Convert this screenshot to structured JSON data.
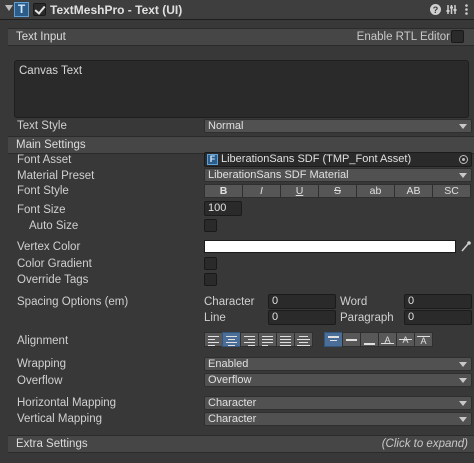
{
  "header": {
    "title": "TextMeshPro - Text (UI)",
    "enabled": true,
    "icons": [
      "help-icon",
      "presets-icon",
      "context-menu-icon"
    ]
  },
  "text_input": {
    "section_title": "Text Input",
    "rtl_label": "Enable RTL Editor",
    "rtl_checked": false,
    "text": "Canvas Text"
  },
  "text_style": {
    "label": "Text Style",
    "value": "Normal"
  },
  "main_settings": {
    "section_title": "Main Settings",
    "font_asset": {
      "label": "Font Asset",
      "value": "LiberationSans SDF (TMP_Font Asset)"
    },
    "material_preset": {
      "label": "Material Preset",
      "value": "LiberationSans SDF Material"
    },
    "font_style": {
      "label": "Font Style",
      "buttons": [
        "B",
        "I",
        "U",
        "S",
        "ab",
        "AB",
        "SC"
      ]
    },
    "font_size": {
      "label": "Font Size",
      "value": "100"
    },
    "auto_size": {
      "label": "Auto Size",
      "checked": false
    },
    "vertex_color": {
      "label": "Vertex Color",
      "color": "#ffffff"
    },
    "color_gradient": {
      "label": "Color Gradient",
      "checked": false
    },
    "override_tags": {
      "label": "Override Tags",
      "checked": false
    },
    "spacing": {
      "label": "Spacing Options (em)",
      "character_label": "Character",
      "character_value": "0",
      "word_label": "Word",
      "word_value": "0",
      "line_label": "Line",
      "line_value": "0",
      "paragraph_label": "Paragraph",
      "paragraph_value": "0"
    },
    "alignment": {
      "label": "Alignment",
      "horizontal_selected": "center",
      "vertical_selected": "top"
    },
    "wrapping": {
      "label": "Wrapping",
      "value": "Enabled"
    },
    "overflow": {
      "label": "Overflow",
      "value": "Overflow"
    },
    "horizontal_mapping": {
      "label": "Horizontal Mapping",
      "value": "Character"
    },
    "vertical_mapping": {
      "label": "Vertical Mapping",
      "value": "Character"
    }
  },
  "extra_settings": {
    "section_title": "Extra Settings",
    "hint": "(Click to expand)"
  },
  "colors": {
    "background": "#383838",
    "accent": "#4a6e98",
    "field": "#2a2a2a",
    "dropdown": "#515151"
  }
}
